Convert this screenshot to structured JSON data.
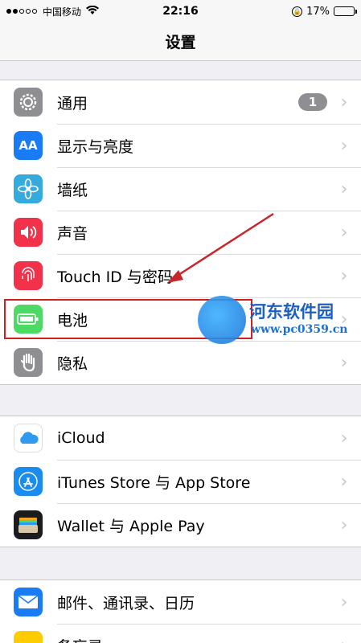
{
  "status_bar": {
    "carrier": "中国移动",
    "time": "22:16",
    "battery_percent": "17%",
    "battery_level": 0.17
  },
  "nav": {
    "title": "设置"
  },
  "groups": [
    {
      "items": [
        {
          "label": "通用",
          "icon": "gear-icon",
          "color": "#8e8e93",
          "badge": "1"
        },
        {
          "label": "显示与亮度",
          "icon": "aa-icon",
          "color": "#1a7cf5"
        },
        {
          "label": "墙纸",
          "icon": "flower-icon",
          "color": "#35aadc"
        },
        {
          "label": "声音",
          "icon": "speaker-icon",
          "color": "#f2324a"
        },
        {
          "label": "Touch ID 与密码",
          "icon": "fingerprint-icon",
          "color": "#f2324a"
        },
        {
          "label": "电池",
          "icon": "battery-icon",
          "color": "#4cd964"
        },
        {
          "label": "隐私",
          "icon": "hand-icon",
          "color": "#8e8e93"
        }
      ]
    },
    {
      "items": [
        {
          "label": "iCloud",
          "icon": "cloud-icon",
          "color": "#ffffff"
        },
        {
          "label": "iTunes Store 与 App Store",
          "icon": "app-store-icon",
          "color": "#1a8cf0"
        },
        {
          "label": "Wallet 与 Apple Pay",
          "icon": "wallet-icon",
          "color": "#1c1c1e"
        }
      ]
    },
    {
      "items": [
        {
          "label": "邮件、通讯录、日历",
          "icon": "mail-icon",
          "color": "#1a7cf5"
        },
        {
          "label": "备忘录",
          "icon": "notes-icon",
          "color": "#ffcc00"
        }
      ]
    }
  ],
  "watermark": {
    "title": "河东软件园",
    "url": "www.pc0359.cn"
  }
}
